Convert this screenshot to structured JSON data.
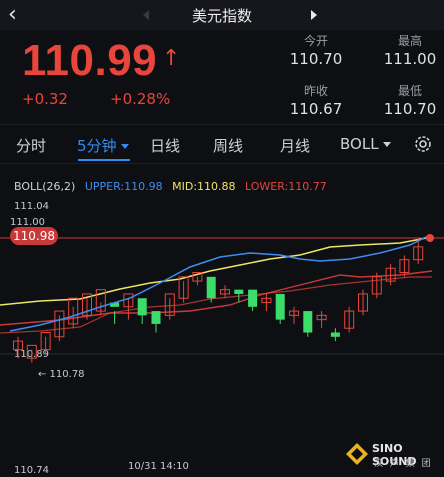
{
  "header": {
    "title": "美元指数",
    "back_icon": "chevron-left-icon"
  },
  "quote": {
    "price": "110.99",
    "change": "+0.32",
    "change_pct": "+0.28%",
    "open_label": "今开",
    "open": "110.70",
    "high_label": "最高",
    "high": "111.00",
    "prev_close_label": "昨收",
    "prev_close": "110.67",
    "low_label": "最低",
    "low": "110.70"
  },
  "tabs": [
    {
      "label": "分时"
    },
    {
      "label": "5分钟",
      "active": true
    },
    {
      "label": "日线"
    },
    {
      "label": "周线"
    },
    {
      "label": "月线"
    },
    {
      "label": "BOLL"
    }
  ],
  "indicator": {
    "name": "BOLL(26,2)",
    "upper": "UPPER:110.98",
    "mid": "MID:110.88",
    "lower": "LOWER:110.77"
  },
  "chart": {
    "y_top": "111.04",
    "y_mark": "111.00",
    "current_tag": "110.98",
    "y_left_mid": "110.89",
    "lower_tag": "← 110.78",
    "y_bottom": "110.74",
    "x_label": "10/31 14:10"
  },
  "watermark": {
    "line1": "SINO SOUND",
    "line2": "汉 声 集 团"
  },
  "colors": {
    "up": "#e8453b",
    "down": "#3ddc6a",
    "upper": "#3d8df0",
    "mid": "#f0e36a",
    "lower": "#c9393a",
    "accent": "#2f8cf0"
  }
}
